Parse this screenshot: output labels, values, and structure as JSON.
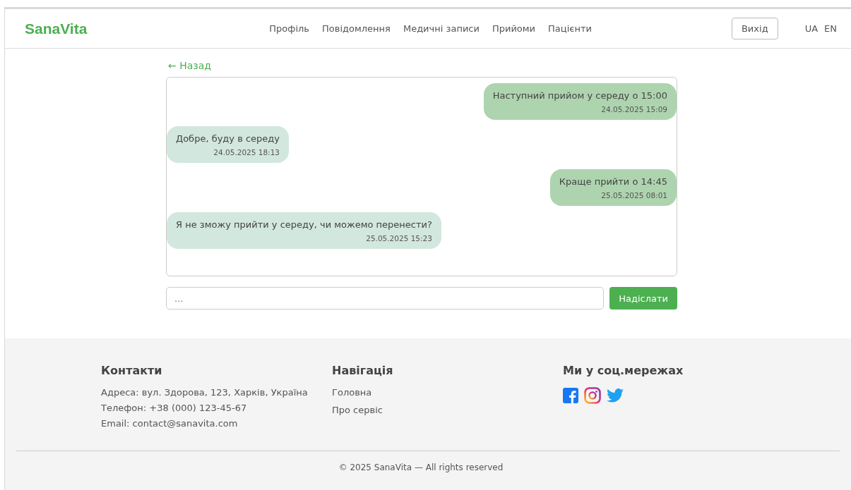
{
  "header": {
    "logo": "SanaVita",
    "nav": [
      {
        "label": "Профіль"
      },
      {
        "label": "Повідомлення"
      },
      {
        "label": "Медичні записи"
      },
      {
        "label": "Прийоми"
      },
      {
        "label": "Пацієнти"
      }
    ],
    "logout": "Вихід",
    "languages": [
      "UA",
      "EN"
    ]
  },
  "back_link": "← Назад",
  "messages": [
    {
      "kind": "sent",
      "text": "Наступний прийом у середу о 15:00",
      "time": "24.05.2025 15:09"
    },
    {
      "kind": "received",
      "text": "Добре, буду в середу",
      "time": "24.05.2025 18:13"
    },
    {
      "kind": "sent",
      "text": "Краще прийти о 14:45",
      "time": "25.05.2025 08:01"
    },
    {
      "kind": "received",
      "text": "Я не зможу прийти у середу, чи можемо перенести?",
      "time": "25.05.2025 15:23"
    }
  ],
  "composer": {
    "placeholder": "...",
    "send": "Надіслати"
  },
  "footer": {
    "contacts": {
      "title": "Контакти",
      "lines": [
        "Адреса: вул. Здорова, 123, Харків, Україна",
        "Телефон: +38 (000) 123-45-67",
        "Email: contact@sanavita.com"
      ]
    },
    "navigation": {
      "title": "Навігація",
      "links": [
        "Головна",
        "Про сервіс"
      ]
    },
    "social": {
      "title": "Ми у соц.мережах"
    },
    "copyright": "© 2025 SanaVita — All rights reserved"
  }
}
